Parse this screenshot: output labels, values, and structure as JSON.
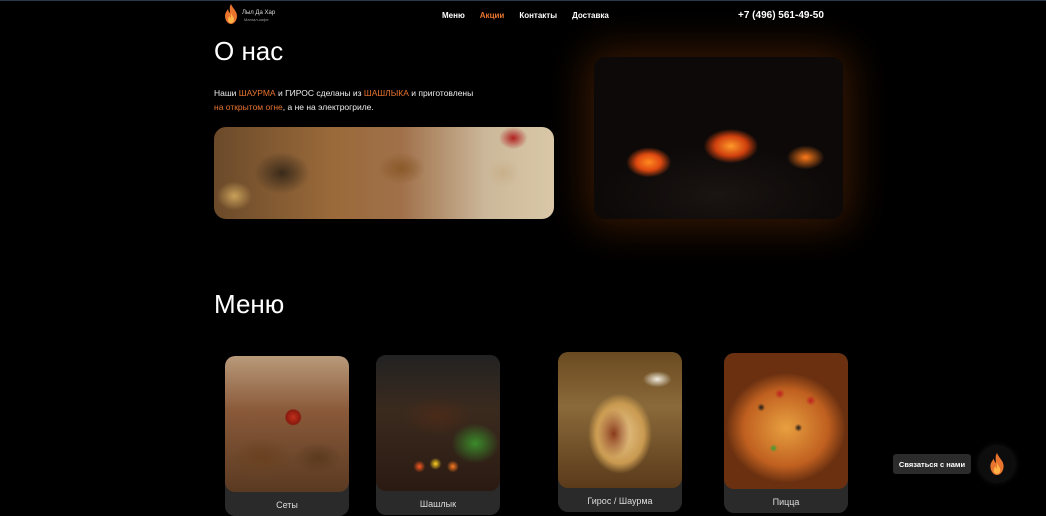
{
  "header": {
    "logo_name": "Лыл Да Хар",
    "logo_tagline": "Мангал-кафе",
    "nav": [
      {
        "label": "Меню",
        "active": false
      },
      {
        "label": "Акции",
        "active": true
      },
      {
        "label": "Контакты",
        "active": false
      },
      {
        "label": "Доставка",
        "active": false
      }
    ],
    "phone": "+7 (496) 561-49-50"
  },
  "about": {
    "title": "О нас",
    "text_parts": [
      "Наши ",
      "ШАУРМА",
      " и ГИРОС сделаны из ",
      "ШАШЛЫКА",
      " и приготовлены ",
      "на открытом огне",
      ", а не на электрогриле."
    ]
  },
  "menu": {
    "title": "Меню",
    "items": [
      {
        "label": "Сеты"
      },
      {
        "label": "Шашлык"
      },
      {
        "label": "Гирос / Шаурма"
      },
      {
        "label": "Пицца"
      }
    ]
  },
  "contact": {
    "label": "Связаться с нами"
  },
  "colors": {
    "accent": "#e8742e",
    "background": "#000000"
  },
  "icons": {
    "logo": "flame-icon",
    "contact": "flame-icon"
  }
}
